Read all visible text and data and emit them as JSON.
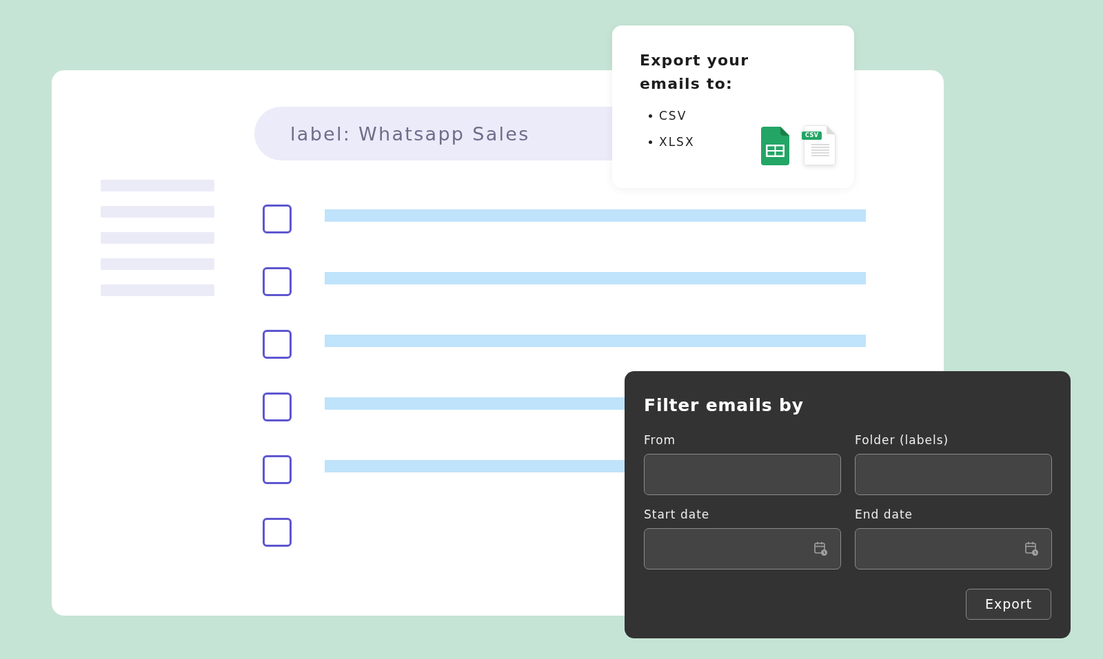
{
  "search": {
    "value": "label: Whatsapp Sales"
  },
  "rows": [
    {
      "kind": "line",
      "checked": false
    },
    {
      "kind": "line",
      "checked": false
    },
    {
      "kind": "line",
      "checked": false
    },
    {
      "kind": "line",
      "checked": false
    },
    {
      "kind": "line",
      "checked": false
    },
    {
      "kind": "blank",
      "checked": false
    }
  ],
  "export_card": {
    "title": "Export your emails to:",
    "formats": [
      "CSV",
      "XLSX"
    ],
    "file_icons": [
      {
        "kind": "spreadsheet"
      },
      {
        "kind": "csv",
        "tag": "CSV"
      }
    ]
  },
  "filter_panel": {
    "title": "Filter emails by",
    "fields": [
      {
        "label": "From",
        "kind": "text"
      },
      {
        "label": "Folder (labels)",
        "kind": "text"
      },
      {
        "label": "Start date",
        "kind": "date"
      },
      {
        "label": "End date",
        "kind": "date"
      }
    ],
    "buttons": [
      "Export"
    ]
  }
}
